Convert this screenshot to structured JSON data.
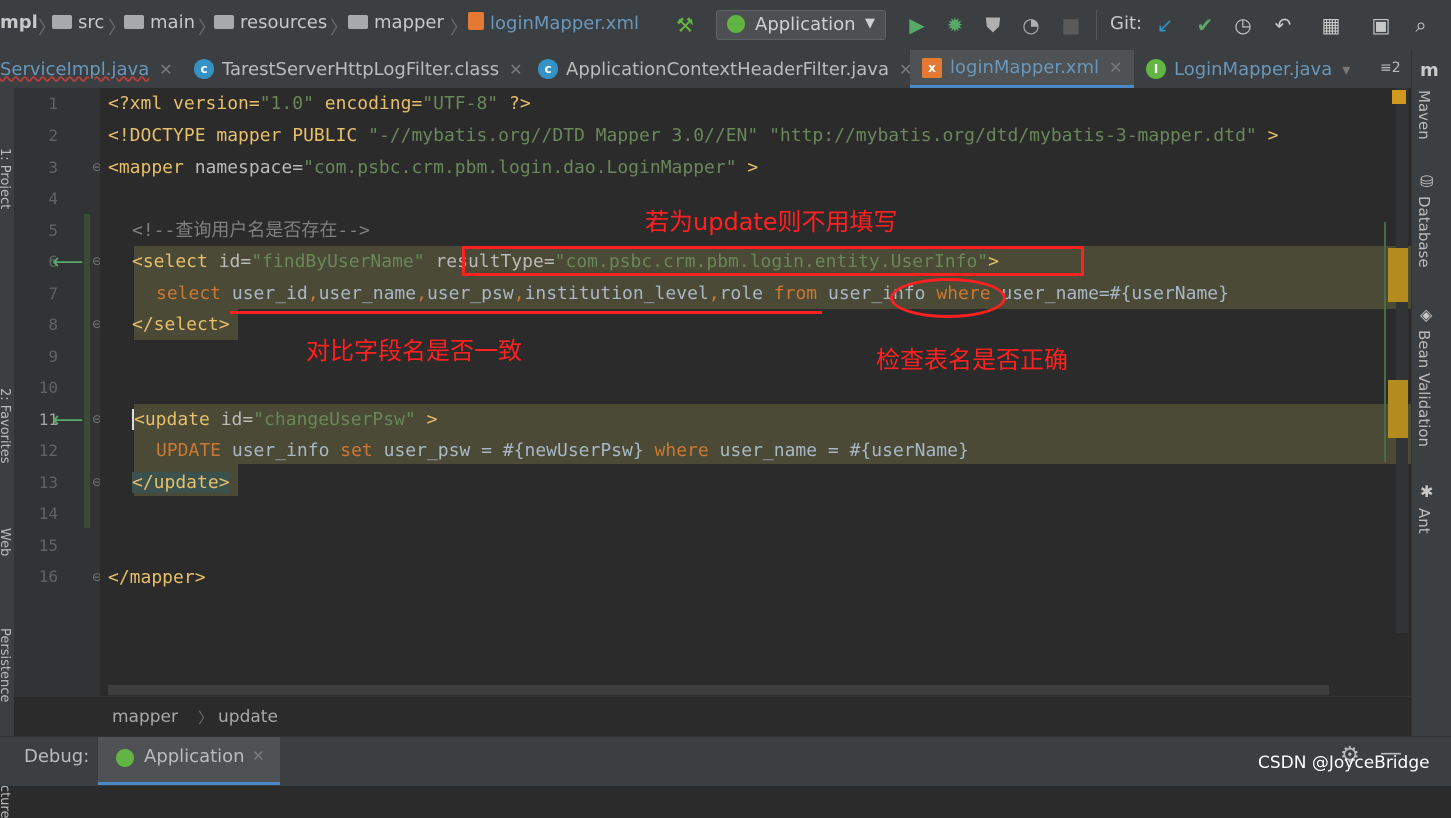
{
  "breadcrumb": {
    "items": [
      "mpl",
      "src",
      "main",
      "resources",
      "mapper",
      "loginMapper.xml"
    ]
  },
  "toolbar": {
    "run_config": "Application",
    "git_label": "Git:"
  },
  "tabs": [
    {
      "label": "ServiceImpl.java",
      "icon": "java-class-icon",
      "active": false
    },
    {
      "label": "TarestServerHttpLogFilter.class",
      "icon": "class-file-icon",
      "active": false
    },
    {
      "label": "ApplicationContextHeaderFilter.java",
      "icon": "class-file-icon",
      "active": false
    },
    {
      "label": "loginMapper.xml",
      "icon": "xml-file-icon",
      "active": true
    },
    {
      "label": "LoginMapper.java",
      "icon": "interface-icon",
      "active": false
    }
  ],
  "tabs_overflow": "≡2",
  "right_tools": [
    "Maven",
    "Database",
    "Bean Validation",
    "Ant"
  ],
  "left_tools": [
    "1: Project",
    "2: Favorites",
    "Web",
    "Persistence",
    "Structure"
  ],
  "line_numbers": [
    "1",
    "2",
    "3",
    "4",
    "5",
    "6",
    "7",
    "8",
    "9",
    "10",
    "11",
    "12",
    "13",
    "14",
    "15",
    "16"
  ],
  "code": {
    "l1": {
      "p1": "<?xml version=",
      "s1": "\"1.0\"",
      "p2": " encoding=",
      "s2": "\"UTF-8\"",
      "p3": " ?>"
    },
    "l2": {
      "p1": "<!DOCTYPE mapper PUBLIC ",
      "s1": "\"-//mybatis.org//DTD Mapper 3.0//EN\"",
      "p2": " ",
      "s2": "\"http://mybatis.org/dtd/mybatis-3-mapper.dtd\"",
      "p3": " >"
    },
    "l3": {
      "p1": "<mapper",
      "p2": " namespace=",
      "s1": "\"com.psbc.crm.pbm.login.dao.LoginMapper\"",
      "p3": " >"
    },
    "l5": {
      "c": "<!--查询用户名是否存在-->"
    },
    "l6": {
      "p1": "<select",
      "p2": " id=",
      "s1": "\"findByUserName\"",
      "p3": " resultType=",
      "s2": "\"com.psbc.crm.pbm.login.entity.UserInfo\"",
      "p4": ">"
    },
    "l7": {
      "k1": "select",
      "t1": " user_id",
      "k2": ",",
      "t2": "user_name",
      "k3": ",",
      "t3": "user_psw",
      "k4": ",",
      "t4": "institution_level",
      "k5": ",",
      "t5": "role ",
      "k6": "from",
      "t6": " user_info ",
      "k7": "where",
      "t7": " user_name=#{userName}"
    },
    "l8": {
      "p1": "</select>"
    },
    "l11": {
      "p1": "<update",
      "p2": " id=",
      "s1": "\"changeUserPsw\"",
      "p3": " >"
    },
    "l12": {
      "k1": "UPDATE",
      "t1": " user_info ",
      "k2": "set",
      "t2": " user_psw = #{newUserPsw} ",
      "k3": "where",
      "t3": " user_name = #{userName}"
    },
    "l13": {
      "p1": "</update>"
    },
    "l16": {
      "p1": "</mapper>"
    }
  },
  "annotations": {
    "top": "若为update则不用填写",
    "fields": "对比字段名是否一致",
    "table": "检查表名是否正确"
  },
  "annotation_color": "#ff2020",
  "editor_breadcrumb": [
    "mapper",
    "update"
  ],
  "debug": {
    "label": "Debug:",
    "tab": "Application"
  },
  "watermark": "CSDN @JoyceBridge"
}
